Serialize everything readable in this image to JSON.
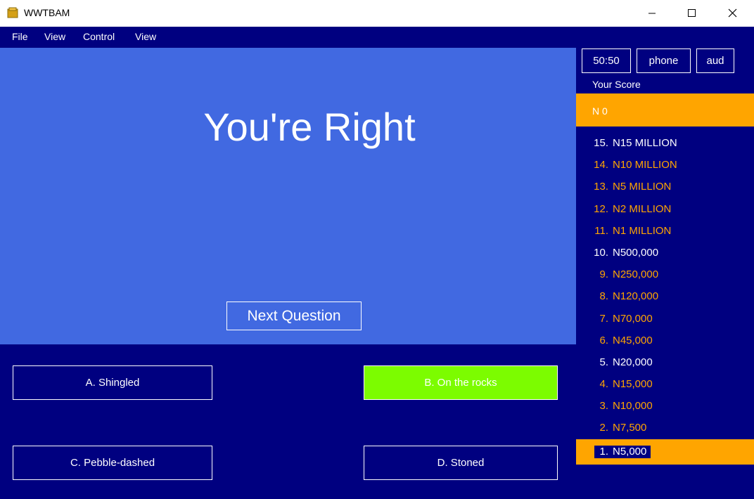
{
  "window": {
    "title": "WWTBAM"
  },
  "menu": [
    "File",
    "View",
    "Control",
    "View"
  ],
  "question": {
    "result_text": "You're Right",
    "next_button": "Next Question"
  },
  "answers": {
    "a": "A. Shingled",
    "b": "B. On the rocks",
    "c": "C. Pebble-dashed",
    "d": "D. Stoned"
  },
  "lifelines": {
    "fifty": "50:50",
    "phone": "phone",
    "audience": "aud"
  },
  "score": {
    "label": "Your Score",
    "value": "N  0"
  },
  "ladder": [
    {
      "num": "15.",
      "amount": "N15 MILLION",
      "color": "white"
    },
    {
      "num": "14.",
      "amount": "N10 MILLION",
      "color": "orange"
    },
    {
      "num": "13.",
      "amount": "N5 MILLION",
      "color": "orange"
    },
    {
      "num": "12.",
      "amount": "N2 MILLION",
      "color": "orange"
    },
    {
      "num": "11.",
      "amount": "N1 MILLION",
      "color": "orange"
    },
    {
      "num": "10.",
      "amount": "N500,000",
      "color": "white"
    },
    {
      "num": "9.",
      "amount": "N250,000",
      "color": "orange"
    },
    {
      "num": "8.",
      "amount": "N120,000",
      "color": "orange"
    },
    {
      "num": "7.",
      "amount": "N70,000",
      "color": "orange"
    },
    {
      "num": "6.",
      "amount": "N45,000",
      "color": "orange"
    },
    {
      "num": "5.",
      "amount": "N20,000",
      "color": "white"
    },
    {
      "num": "4.",
      "amount": "N15,000",
      "color": "orange"
    },
    {
      "num": "3.",
      "amount": "N10,000",
      "color": "orange"
    },
    {
      "num": "2.",
      "amount": "N7,500",
      "color": "orange"
    },
    {
      "num": "1.",
      "amount": "N5,000",
      "color": "current"
    }
  ],
  "colors": {
    "background": "#000080",
    "question_panel": "#4169e1",
    "correct_answer": "#7cfc00",
    "highlight": "#ffa500"
  }
}
